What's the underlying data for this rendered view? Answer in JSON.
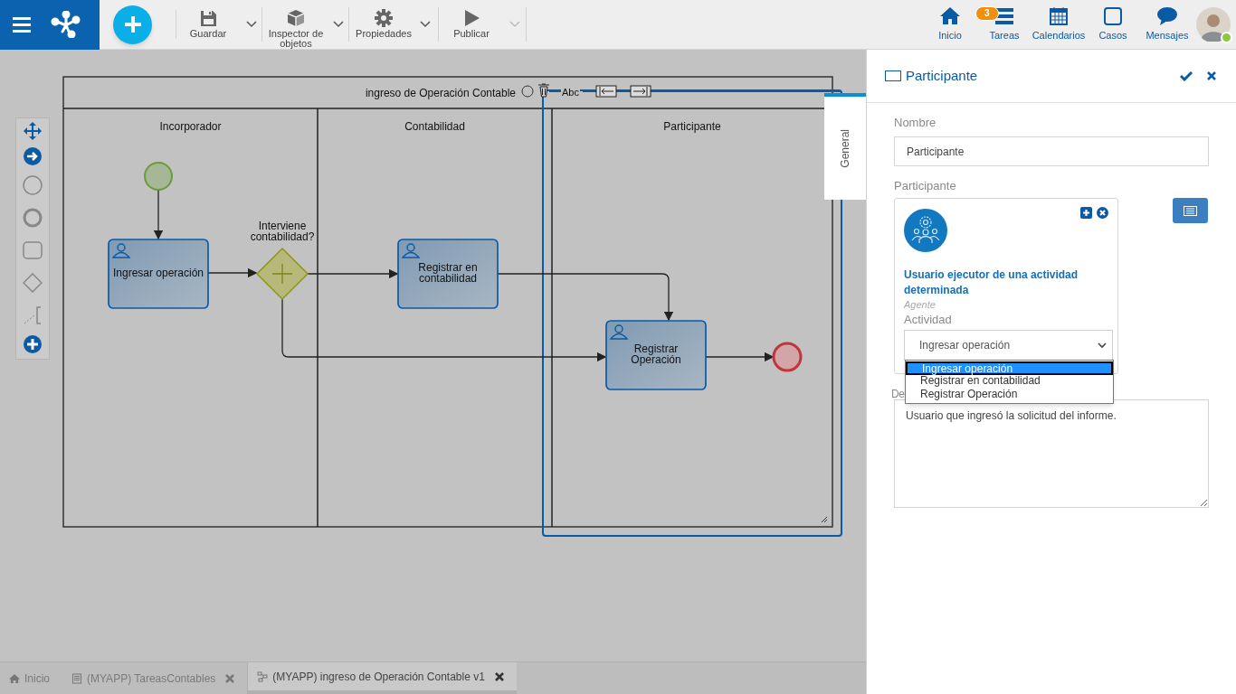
{
  "toolbar": [
    {
      "label": "Guardar",
      "caret_enabled": true
    },
    {
      "label": "Inspector de objetos",
      "caret_enabled": true
    },
    {
      "label": "Propiedades",
      "caret_enabled": true
    },
    {
      "label": "Publicar",
      "caret_enabled": false
    }
  ],
  "nav": [
    {
      "label": "Inicio"
    },
    {
      "label": "Tareas",
      "badge": "3"
    },
    {
      "label": "Calendarios"
    },
    {
      "label": "Casos"
    },
    {
      "label": "Mensajes"
    }
  ],
  "user": {
    "online": true
  },
  "diagram": {
    "pool_title": "ingreso de Operación Contable",
    "lanes": [
      "Incorporador",
      "Contabilidad",
      "Participante"
    ],
    "tasks": [
      {
        "label": "Ingresar operación"
      },
      {
        "label": "Registrar en contabilidad"
      },
      {
        "label": "Registrar Operación"
      }
    ],
    "gateway_label": "Interviene contabilidad?",
    "tool_text": "Abc"
  },
  "side_tabs": [
    {
      "label": "General",
      "selected": true
    }
  ],
  "panel": {
    "title": "Participante",
    "nombre_label": "Nombre",
    "nombre_value": "Participante",
    "participante_label": "Participante",
    "card": {
      "title": "Usuario ejecutor de una actividad determinada",
      "type": "Agente",
      "actividad_label": "Actividad",
      "actividad_value": "Ingresar operación"
    },
    "dropdown_options": [
      {
        "label": "Ingresar operación",
        "selected": true
      },
      {
        "label": "Registrar en contabilidad",
        "selected": false
      },
      {
        "label": "Registrar Operación",
        "selected": false
      }
    ],
    "descripcion_label": "De",
    "descripcion_value": "Usuario que ingresó la solicitud del informe."
  },
  "bottom_tabs": [
    {
      "label": "Inicio",
      "selected": false,
      "closable": false
    },
    {
      "label": "(MYAPP) TareasContables",
      "selected": false,
      "closable": true
    },
    {
      "label": "(MYAPP) ingreso de Operación Contable v1",
      "selected": true,
      "closable": true
    }
  ]
}
